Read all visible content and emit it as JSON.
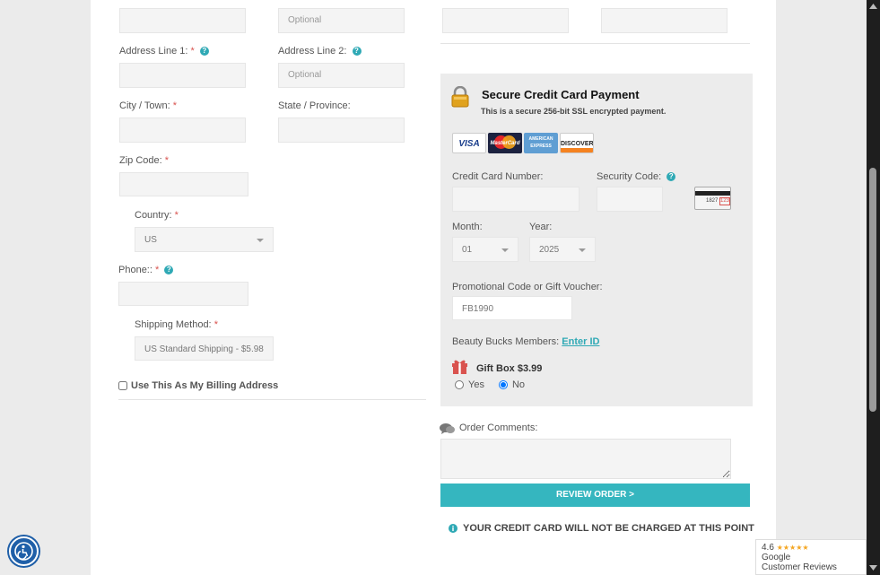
{
  "shipping": {
    "top_optional_placeholder": "Optional",
    "address1_label": "Address Line 1:",
    "address2_label": "Address Line 2:",
    "address2_placeholder": "Optional",
    "city_label": "City / Town:",
    "state_label": "State / Province:",
    "zip_label": "Zip Code:",
    "country_label": "Country:",
    "country_value": "US",
    "phone_label": "Phone::",
    "method_label": "Shipping Method:",
    "method_value": "US Standard Shipping - $5.98",
    "billing_checkbox_label": "Use This As My Billing Address",
    "required_mark": "*",
    "help_glyph": "?"
  },
  "payment": {
    "title": "Secure Credit Card Payment",
    "subtitle": "This is a secure 256-bit SSL encrypted payment.",
    "cards": [
      "VISA",
      "MasterCard",
      "AMERICAN EXPRESS",
      "DISCOVER"
    ],
    "cc_number_label": "Credit Card Number:",
    "security_code_label": "Security Code:",
    "cvv_card_text": "1827",
    "cvv_box_text": "123",
    "month_label": "Month:",
    "month_value": "01",
    "year_label": "Year:",
    "year_value": "2025",
    "promo_label": "Promotional Code or Gift Voucher:",
    "promo_value": "FB1990",
    "beauty_bucks_label": "Beauty Bucks Members:",
    "beauty_bucks_link": "Enter ID",
    "gift_box_label": "Gift Box $3.99",
    "gift_yes": "Yes",
    "gift_no": "No"
  },
  "order": {
    "comments_label": "Order Comments:",
    "review_button": "REVIEW ORDER  >",
    "notice": "YOUR CREDIT CARD WILL NOT BE CHARGED AT THIS POINT"
  },
  "google_badge": {
    "rating": "4.6",
    "stars": "★★★★★",
    "line1": "Google",
    "line2": "Customer Reviews"
  },
  "colors": {
    "accent": "#35b6bf",
    "required": "#d9534f"
  }
}
